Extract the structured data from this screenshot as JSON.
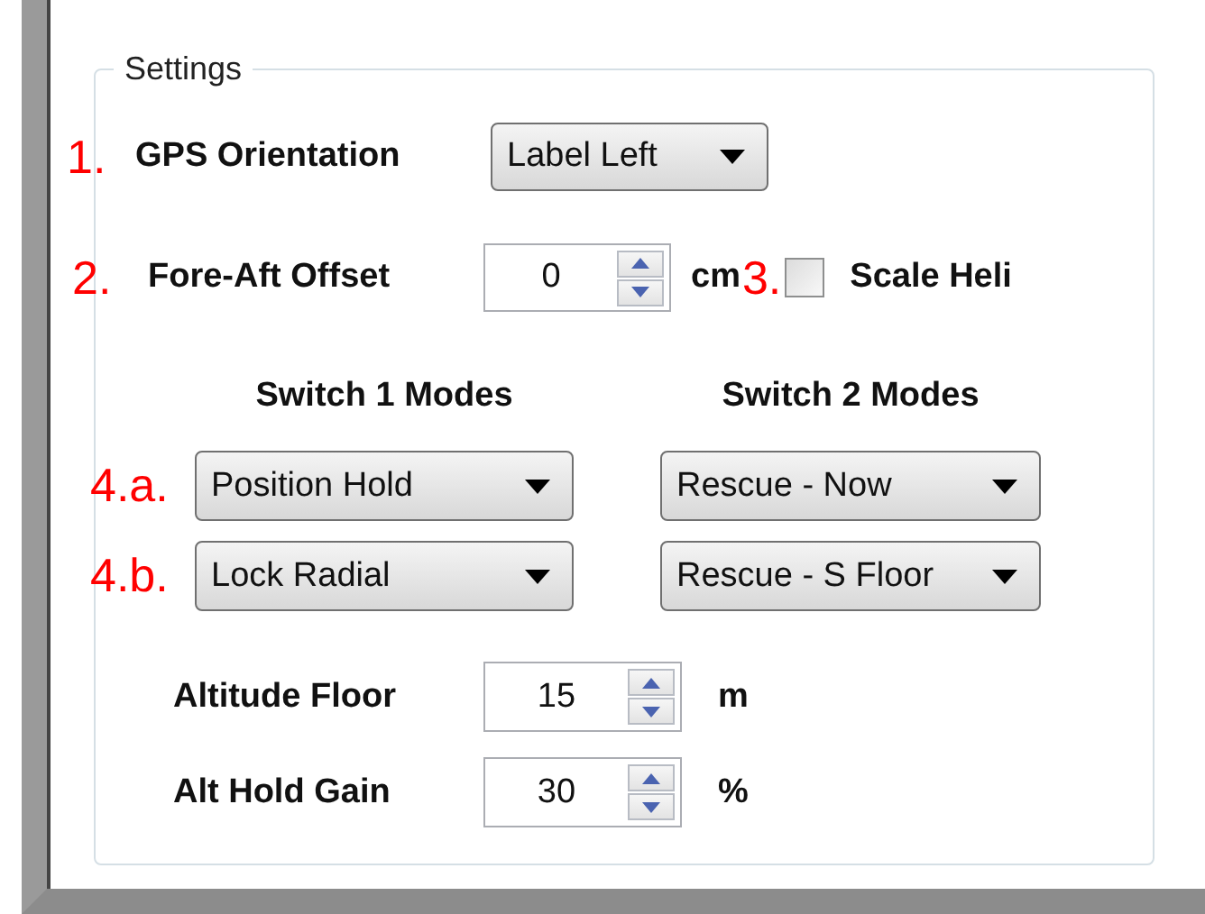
{
  "settings": {
    "title": "Settings"
  },
  "gps_orientation": {
    "marker": "1.",
    "label": "GPS Orientation",
    "value": "Label Left"
  },
  "fore_aft_offset": {
    "marker": "2.",
    "label": "Fore-Aft Offset",
    "value": "0",
    "unit": "cm"
  },
  "scale_heli": {
    "marker": "3.",
    "label": "Scale Heli",
    "checked": false
  },
  "switch_headings": [
    "Switch 1 Modes",
    "Switch 2 Modes"
  ],
  "mode_rows": [
    {
      "marker": "4.a.",
      "values": [
        "Position Hold",
        "Rescue - Now"
      ]
    },
    {
      "marker": "4.b.",
      "values": [
        "Lock Radial",
        "Rescue - S Floor"
      ]
    }
  ],
  "numeric_rows": [
    {
      "label": "Altitude Floor",
      "value": "15",
      "unit": "m"
    },
    {
      "label": "Alt Hold Gain",
      "value": "30",
      "unit": "%"
    }
  ]
}
